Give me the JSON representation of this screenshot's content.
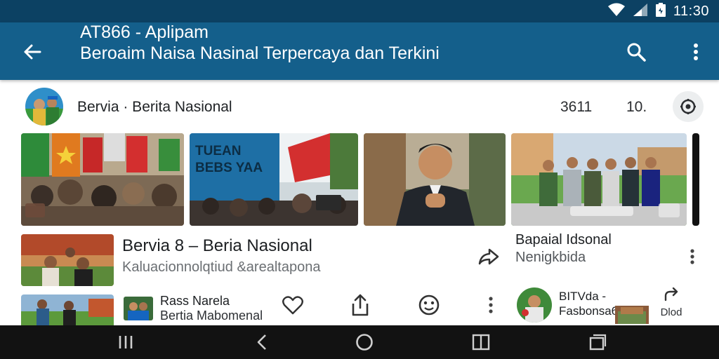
{
  "status_bar": {
    "time": "11:30",
    "icons": [
      "wifi-icon",
      "signal-icon",
      "battery-icon"
    ]
  },
  "app_bar": {
    "title": "AT866 - Aplipam",
    "subtitle": "Beroaim Naisa Nasinal Terpercaya dan Terkini",
    "icons": [
      "back-arrow-icon",
      "search-icon",
      "more-vert-icon"
    ]
  },
  "channel": {
    "name": "Bervia · Berita Nasional",
    "count": "3611",
    "stat": "10.",
    "icons": [
      "settings-icon"
    ]
  },
  "thumbnails": {
    "banner_text": "TUEAN BEBS YAA",
    "items": [
      "crowd-flags-photo",
      "rally-banner-photo",
      "official-portrait-photo",
      "group-field-photo"
    ]
  },
  "feed_item_1": {
    "title": "Bervia 8 – Beria Nasional",
    "subtitle": "Kaluacionnolqtiud &arealtapona",
    "icons": [
      "share-forward-icon"
    ]
  },
  "feed_item_2": {
    "title": "Bapaial Idsonal",
    "subtitle": "Nenigkbida",
    "icons": [
      "more-vert-icon"
    ]
  },
  "feed_item_3": {
    "title": "Rass Narela",
    "subtitle": "Bertia Mabomenal",
    "icons": [
      "heart-icon",
      "share-icon",
      "emoji-icon",
      "more-vert-icon"
    ]
  },
  "feed_item_4": {
    "title": "BITVda -",
    "subtitle": "Fasbonsa6",
    "action_label": "Dlod",
    "icons": [
      "redo-arrow-icon"
    ]
  },
  "nav_bar": {
    "icons": [
      "recents-lines-icon",
      "back-triangle-icon",
      "home-circle-icon",
      "split-screen-icon",
      "overview-icon"
    ]
  },
  "colors": {
    "status_bar": "#0c4163",
    "app_bar": "#145f8b",
    "nav_bar": "#121212"
  }
}
